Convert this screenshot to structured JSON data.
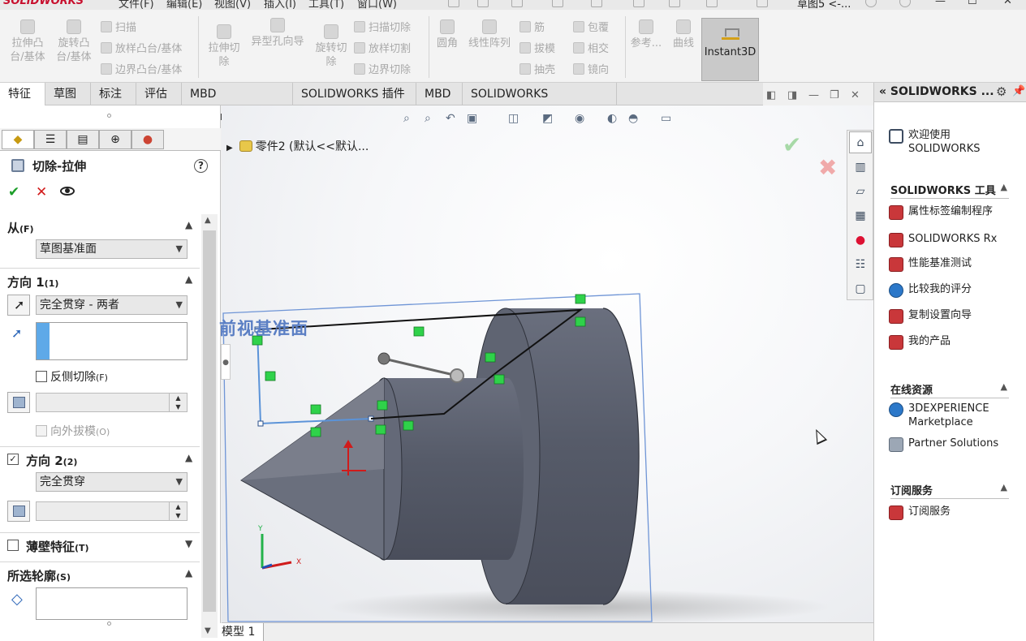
{
  "menubar": {
    "logo": "SOLIDWORKS",
    "menus": [
      "文件(F)",
      "编辑(E)",
      "视图(V)",
      "插入(I)",
      "工具(T)",
      "窗口(W)"
    ],
    "doc_title": "草图5 <-..."
  },
  "ribbon": {
    "extrude_boss": "拉伸凸\n台/基体",
    "revolve_boss": "旋转凸\n台/基体",
    "sweep": "扫描",
    "loft": "放样凸台/基体",
    "boundary": "边界凸台/基体",
    "extrude_cut": "拉伸切\n除",
    "hole_wizard": "异型孔向导",
    "revolve_cut": "旋转切\n除",
    "swept_cut": "扫描切除",
    "lofted_cut": "放样切割",
    "boundary_cut": "边界切除",
    "fillet": "圆角",
    "linear_pattern": "线性阵列",
    "rib": "筋",
    "draft": "拔模",
    "shell": "抽壳",
    "wrap": "包覆",
    "intersect": "相交",
    "mirror": "镜向",
    "reference": "参考...",
    "curves": "曲线",
    "instant3d": "Instant3D"
  },
  "tabs": [
    "特征",
    "草图",
    "标注",
    "评估",
    "MBD Dimensions",
    "SOLIDWORKS 插件",
    "MBD",
    "SOLIDWORKS Inspection"
  ],
  "property_manager": {
    "title": "切除-拉伸",
    "from_label": "从",
    "from_key": "(F)",
    "from_value": "草图基准面",
    "dir1_label": "方向 1",
    "dir1_key": "(1)",
    "dir1_end": "完全贯穿 - 两者",
    "flip_side": "反侧切除",
    "flip_side_key": "(F)",
    "draft_outward": "向外拔模",
    "draft_outward_key": "(O)",
    "dir2_label": "方向 2",
    "dir2_key": "(2)",
    "dir2_end": "完全贯穿",
    "thin_feature": "薄壁特征",
    "thin_feature_key": "(T)",
    "selected_contours": "所选轮廓",
    "selected_contours_key": "(S)"
  },
  "graphics": {
    "tree_item": "零件2 (默认<<默认...",
    "plane_label": "前视基准面",
    "bottom_tab": "模型 1"
  },
  "task_pane": {
    "title": "SOLIDWORKS ...",
    "welcome": "欢迎使用\nSOLIDWORKS",
    "tools_header": "SOLIDWORKS 工具",
    "tools": [
      "属性标签编制程序",
      "SOLIDWORKS Rx",
      "性能基准测试",
      "比较我的评分",
      "复制设置向导",
      "我的产品"
    ],
    "online_header": "在线资源",
    "marketplace": "3DEXPERIENCE\nMarketplace",
    "partner": "Partner Solutions",
    "subscription_header": "订阅服务",
    "subscription_item": "订阅服务"
  },
  "colors": {
    "accent_blue": "#5b7fc4",
    "sketch_green": "#2fd24a",
    "model_gray": "#5d6272",
    "ok_green": "#1c9e29",
    "cancel_red": "#d21b1b"
  }
}
